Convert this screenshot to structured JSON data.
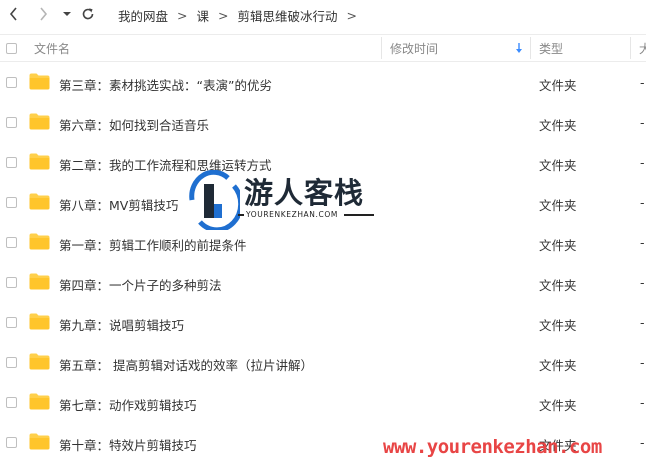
{
  "breadcrumb": [
    "我的网盘",
    "课",
    "剪辑思维破冰行动"
  ],
  "columns": {
    "name": "文件名",
    "modified": "修改时间",
    "type": "类型",
    "size": "大"
  },
  "rows": [
    {
      "name": "第三章：素材挑选实战：“表演”的优劣",
      "type": "文件夹",
      "size": "-"
    },
    {
      "name": "第六章：如何找到合适音乐",
      "type": "文件夹",
      "size": "-"
    },
    {
      "name": "第二章：我的工作流程和思维运转方式",
      "type": "文件夹",
      "size": "-"
    },
    {
      "name": "第八章：MV剪辑技巧",
      "type": "文件夹",
      "size": "-"
    },
    {
      "name": "第一章：剪辑工作顺利的前提条件",
      "type": "文件夹",
      "size": "-"
    },
    {
      "name": "第四章：一个片子的多种剪法",
      "type": "文件夹",
      "size": "-"
    },
    {
      "name": "第九章：说唱剪辑技巧",
      "type": "文件夹",
      "size": "-"
    },
    {
      "name": "第五章： 提高剪辑对话戏的效率（拉片讲解）",
      "type": "文件夹",
      "size": "-"
    },
    {
      "name": "第七章：动作戏剪辑技巧",
      "type": "文件夹",
      "size": "-"
    },
    {
      "name": "第十章：特效片剪辑技巧",
      "type": "文件夹",
      "size": "-"
    }
  ],
  "watermark": {
    "title": "游人客栈",
    "subtitle": "YOURENKEZHAN.COM",
    "url": "www.yourenkezhan.com"
  },
  "colors": {
    "folder": "#ffd04b",
    "accent": "#3b8cff",
    "watermark_url": "#e84545"
  },
  "icons": [
    "back-arrow-icon",
    "forward-arrow-icon",
    "dropdown-caret-icon",
    "refresh-icon",
    "folder-icon",
    "sort-down-arrow-icon"
  ]
}
